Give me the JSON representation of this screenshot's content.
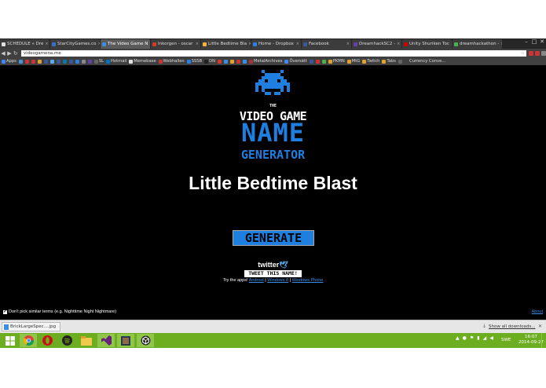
{
  "browser": {
    "tabs": [
      {
        "label": "SCHEDULE « Dre",
        "color": "#e0e0e0"
      },
      {
        "label": "StarCityGames.co",
        "color": "#3a6fc4"
      },
      {
        "label": "The Video Game N",
        "color": "#3a8ee6",
        "active": true
      },
      {
        "label": "Inkorgen - oscar",
        "color": "#d23b2a"
      },
      {
        "label": "Little Bedtime Bla",
        "color": "#f2b23e"
      },
      {
        "label": "Home - Dropbox",
        "color": "#2a7fe0"
      },
      {
        "label": "Facebook",
        "color": "#3b5998"
      },
      {
        "label": "DreamhackSC2 -",
        "color": "#6441a5"
      },
      {
        "label": "Unity Shuriken Toc",
        "color": "#cc0000"
      },
      {
        "label": "dreamhackathon -",
        "color": "#4caf50"
      }
    ],
    "window_controls": [
      "–",
      "□",
      "✕"
    ],
    "nav": {
      "back": "◀",
      "forward": "▶",
      "reload": "↻"
    },
    "address": "videogamena.me",
    "star": "☆",
    "bookmarks": [
      {
        "label": "Apps",
        "color": "#4285f4"
      },
      {
        "label": "",
        "color": "#4a90d9"
      },
      {
        "label": "",
        "color": "#cc3333"
      },
      {
        "label": "",
        "color": "#cc3333"
      },
      {
        "label": "",
        "color": "#e0a030"
      },
      {
        "label": "",
        "color": "#3b5998"
      },
      {
        "label": "",
        "color": "#55acee"
      },
      {
        "label": "",
        "color": "#3b5998"
      },
      {
        "label": "",
        "color": "#0e76a8"
      },
      {
        "label": "",
        "color": "#3b5998"
      },
      {
        "label": "",
        "color": "#2a7fe0"
      },
      {
        "label": "",
        "color": "#888888"
      },
      {
        "label": "",
        "color": "#6441a5"
      },
      {
        "label": "SL",
        "color": "#666666"
      },
      {
        "label": "Hotmail",
        "color": "#0072c6"
      },
      {
        "label": "Memebase",
        "color": "#e0e0e0"
      },
      {
        "label": "Webhallen",
        "color": "#cc3333"
      },
      {
        "label": "SSSB",
        "color": "#2a7fe0"
      },
      {
        "label": "DN",
        "color": "#222222"
      },
      {
        "label": "",
        "color": "#d23b2a"
      },
      {
        "label": "",
        "color": "#3a8ee6"
      },
      {
        "label": "",
        "color": "#e0a030"
      },
      {
        "label": "",
        "color": "#cc3333"
      },
      {
        "label": "",
        "color": "#3a8ee6"
      },
      {
        "label": "MetalArchives",
        "color": "#aa3333"
      },
      {
        "label": "Översätt",
        "color": "#4285f4"
      },
      {
        "label": "",
        "color": "#3b5998"
      },
      {
        "label": "",
        "color": "#cc3333"
      },
      {
        "label": "",
        "color": "#4caf50"
      },
      {
        "label": "PKMN",
        "color": "#e0a030"
      },
      {
        "label": "MtG",
        "color": "#e0a030"
      },
      {
        "label": "Twitch",
        "color": "#e0a030"
      },
      {
        "label": "Tabs",
        "color": "#e0a030"
      },
      {
        "label": "",
        "color": "#666666"
      },
      {
        "label": "Currency Conve...",
        "color": "#404040"
      }
    ]
  },
  "page": {
    "logo": {
      "the": "THE",
      "line1": "VIDEO GAME",
      "line2": "NAME",
      "line3": "GENERATOR"
    },
    "generated_name": "Little Bedtime Blast",
    "generate_label": "GENERATE",
    "twitter_label": "twitter",
    "tweet_label": "TWEET THIS NAME!",
    "apps_prefix": "Try the apps!",
    "apps_links": [
      "Android",
      "Windows 8",
      "Windows Phone"
    ],
    "apps_sep": "|",
    "option_label": "Don't pick similar terms (e.g. Nighttime Night Nightmare)",
    "option_checked": "✔",
    "about_label": "About",
    "accent_color": "#1e7fe0"
  },
  "downloads": {
    "file": "BrickLargeSpec....jpg",
    "show_all": "Show all downloads...",
    "close": "✕"
  },
  "taskbar": {
    "apps": [
      "windows-explorer",
      "chrome",
      "opera",
      "spotify",
      "file-explorer",
      "visual-studio",
      "photoshop",
      "unity"
    ],
    "lang": "SWE",
    "time": "16:07",
    "date": "2014-09-27"
  }
}
